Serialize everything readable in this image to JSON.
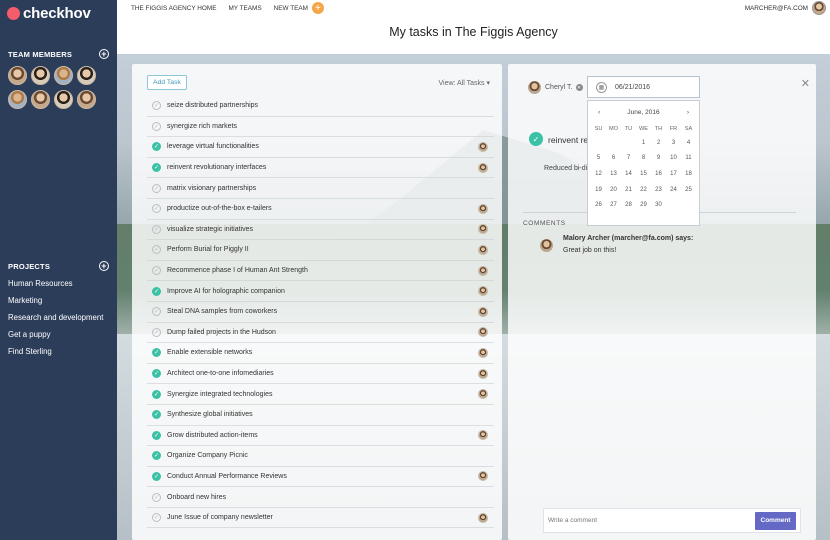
{
  "sidebar": {
    "logo": "checkhov",
    "team_members_label": "TEAM MEMBERS",
    "projects_label": "PROJECTS",
    "projects": [
      "Human Resources",
      "Marketing",
      "Research and development",
      "Get a puppy",
      "Find Sterling"
    ]
  },
  "topnav": {
    "items": [
      "THE FIGGIS AGENCY HOME",
      "MY TEAMS",
      "NEW TEAM"
    ],
    "user_email": "MARCHER@FA.COM"
  },
  "page_title": "My tasks in The Figgis Agency",
  "tasks_panel": {
    "add_task_label": "Add Task",
    "view_label": "View: All Tasks",
    "tasks": [
      {
        "name": "seize distributed partnerships",
        "done": false,
        "assigned": false
      },
      {
        "name": "synergize rich markets",
        "done": false,
        "assigned": false
      },
      {
        "name": "leverage virtual functionalities",
        "done": true,
        "assigned": true
      },
      {
        "name": "reinvent revolutionary interfaces",
        "done": true,
        "assigned": true
      },
      {
        "name": "matrix visionary partnerships",
        "done": false,
        "assigned": false
      },
      {
        "name": "productize out-of-the-box e-tailers",
        "done": false,
        "assigned": true
      },
      {
        "name": "visualize strategic initiatives",
        "done": false,
        "assigned": true
      },
      {
        "name": "Perform Burial for Piggly II",
        "done": false,
        "assigned": true
      },
      {
        "name": "Recommence phase I of Human Ant Strength",
        "done": false,
        "assigned": true
      },
      {
        "name": "Improve AI for holographic companion",
        "done": true,
        "assigned": true
      },
      {
        "name": "Steal DNA samples from coworkers",
        "done": false,
        "assigned": true
      },
      {
        "name": "Dump failed projects in the Hudson",
        "done": false,
        "assigned": true
      },
      {
        "name": "Enable extensible networks",
        "done": true,
        "assigned": true
      },
      {
        "name": "Architect one-to-one infomediaries",
        "done": true,
        "assigned": true
      },
      {
        "name": "Synergize integrated technologies",
        "done": true,
        "assigned": true
      },
      {
        "name": "Synthesize global initiatives",
        "done": true,
        "assigned": false
      },
      {
        "name": "Grow distributed action-items",
        "done": true,
        "assigned": true
      },
      {
        "name": "Organize Company Picnic",
        "done": true,
        "assigned": false
      },
      {
        "name": "Conduct Annual Performance Reviews",
        "done": true,
        "assigned": true
      },
      {
        "name": "Onboard new hires",
        "done": false,
        "assigned": false
      },
      {
        "name": "June Issue of company newsletter",
        "done": false,
        "assigned": true
      }
    ]
  },
  "detail": {
    "assignee": "Cheryl T.",
    "date": "06/21/2016",
    "title": "reinvent rev",
    "description": "Reduced bi-di",
    "comments_label": "COMMENTS",
    "comment_author": "Malory Archer (marcher@fa.com) says:",
    "comment_text": "Great job on this!",
    "comment_placeholder": "Write a comment",
    "comment_button": "Comment"
  },
  "calendar": {
    "month": "June, 2016",
    "prev": "‹",
    "next": "›",
    "weekdays": [
      "SU",
      "MO",
      "TU",
      "WE",
      "TH",
      "FR",
      "SA"
    ],
    "leading_blanks": 3,
    "days": [
      "1",
      "2",
      "3",
      "4",
      "5",
      "6",
      "7",
      "8",
      "9",
      "10",
      "11",
      "12",
      "13",
      "14",
      "15",
      "16",
      "17",
      "18",
      "19",
      "20",
      "21",
      "22",
      "23",
      "24",
      "25",
      "26",
      "27",
      "28",
      "29",
      "30"
    ]
  },
  "colors": {
    "sidebar": "#2c3d5a",
    "logo_dot": "#f25c6b",
    "check_done": "#3bc1a6",
    "new_team_plus": "#f5a54a",
    "comment_button": "#6469c6"
  }
}
